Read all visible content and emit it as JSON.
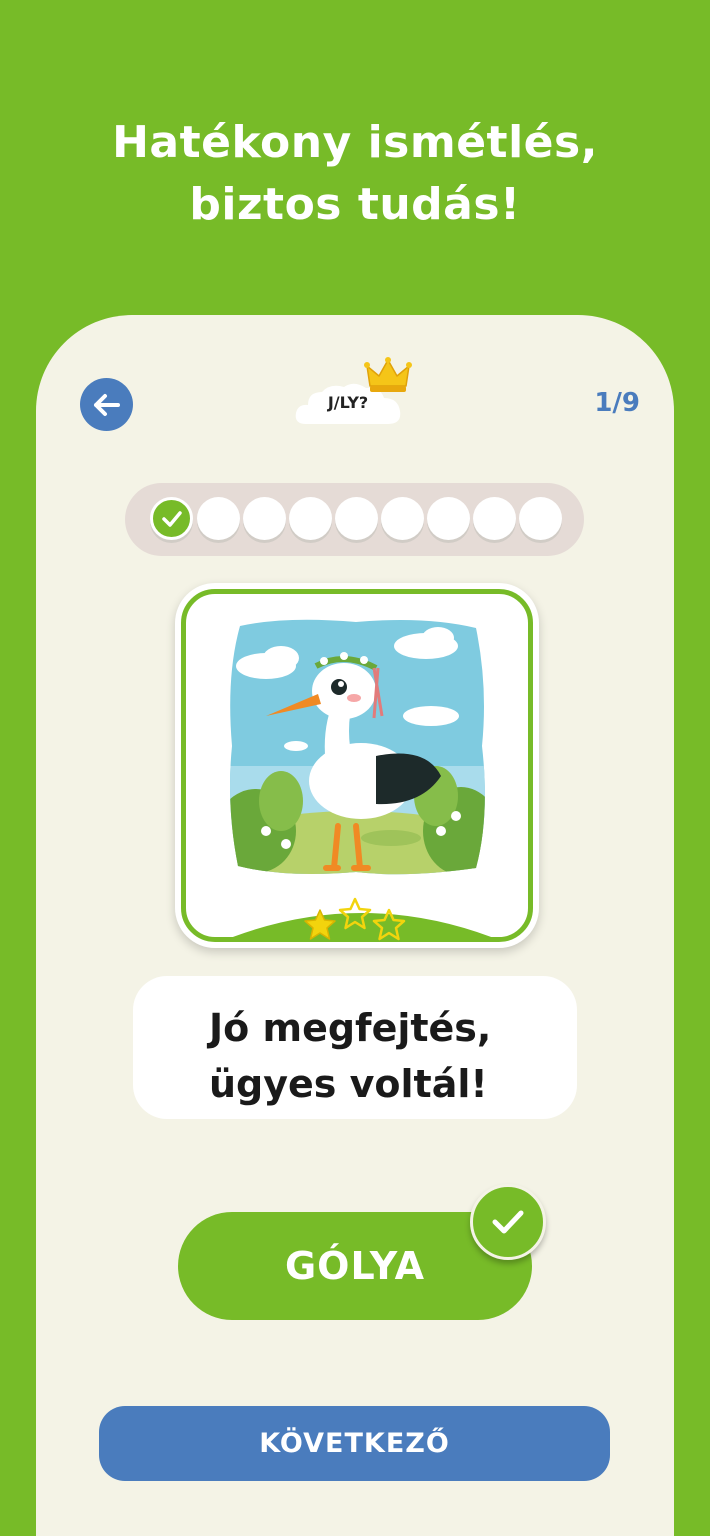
{
  "headline": {
    "line1": "Hatékony ismétlés,",
    "line2": "biztos tudás!"
  },
  "header": {
    "back_icon": "arrow-left-icon",
    "badge_label": "J/LY?",
    "badge_icon": "crown-icon",
    "counter": "1/9"
  },
  "progress": {
    "total": 9,
    "completed": 1
  },
  "card": {
    "image": "stork-illustration",
    "stars_earned": 1,
    "stars_total": 3
  },
  "feedback": {
    "line1": "Jó megfejtés,",
    "line2": "ügyes voltál!"
  },
  "answer": {
    "label": "GÓLYA",
    "status_icon": "checkmark-icon"
  },
  "next_button": {
    "label": "KÖVETKEZŐ"
  },
  "colors": {
    "background": "#77bb28",
    "panel": "#f4f3e6",
    "accent_blue": "#4a7cbd",
    "star": "#f2d40d"
  }
}
